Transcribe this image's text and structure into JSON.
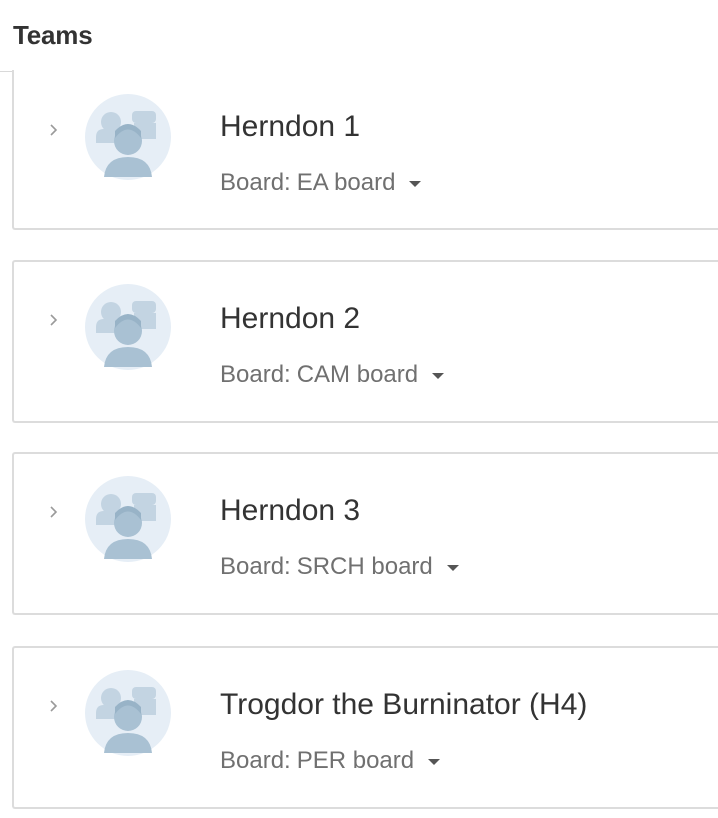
{
  "header": {
    "title": "Teams"
  },
  "teams": [
    {
      "name": "Herndon 1",
      "board_prefix": "Board:",
      "board": "EA board"
    },
    {
      "name": "Herndon 2",
      "board_prefix": "Board:",
      "board": "CAM board"
    },
    {
      "name": "Herndon 3",
      "board_prefix": "Board:",
      "board": "SRCH board"
    },
    {
      "name": "Trogdor the Burninator (H4)",
      "board_prefix": "Board:",
      "board": "PER board"
    }
  ],
  "icons": {
    "expand": "chevron-right-icon",
    "avatar": "team-group-avatar-icon",
    "dropdown": "caret-down-icon"
  },
  "colors": {
    "avatar_bg": "#e6eef6",
    "avatar_front": "#a9c1d3",
    "avatar_back": "#c3d4e2",
    "border": "#dcdcdc"
  }
}
